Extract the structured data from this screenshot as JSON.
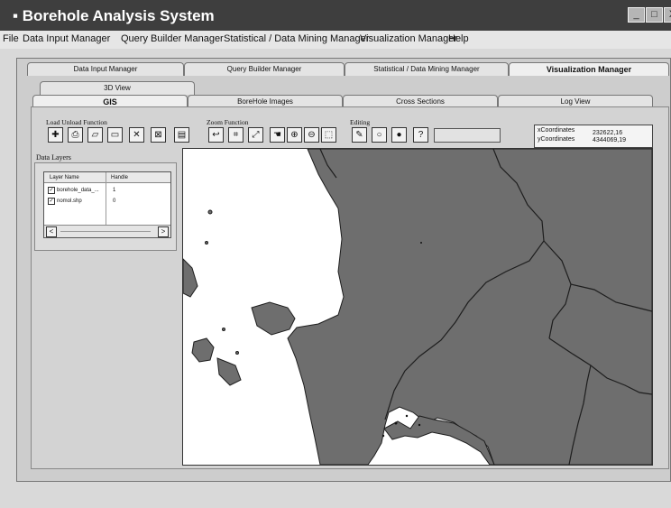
{
  "window": {
    "title": "Borehole Analysis System",
    "controls": {
      "minimize": "_",
      "maximize": "□",
      "close": "X"
    }
  },
  "menu": [
    "File",
    "Data Input Manager",
    "Query Builder Manager",
    "Statistical / Data Mining Manager",
    "Visualization Manager",
    "Help"
  ],
  "manager_tabs": [
    "Data Input Manager",
    "Query Builder Manager",
    "Statistical / Data Mining Manager",
    "Visualization Manager"
  ],
  "view_tabs": {
    "row1": [
      "3D View"
    ],
    "row2": [
      "GIS",
      "BoreHole Images",
      "Cross Sections",
      "Log View"
    ]
  },
  "toolbar": {
    "load_label": "Load Unload Function",
    "zoom_label": "Zoom Function",
    "editing_label": "Editing"
  },
  "coordinates": {
    "x_label": "xCoordinates",
    "x_value": "232622,16",
    "y_label": "yCoordinates",
    "y_value": "4344069,19"
  },
  "data_layers": {
    "title": "Data Layers",
    "columns": [
      "Layer Name",
      "Handle"
    ],
    "rows": [
      {
        "name": "borehole_data_...",
        "handle": "1",
        "checked": true
      },
      {
        "name": "nomol.shp",
        "handle": "0",
        "checked": true
      }
    ],
    "scroll_left": "<",
    "scroll_right": ">"
  },
  "colors": {
    "land": "#6e6e6e",
    "sea": "#ffffff",
    "title_bar": "#3e3e3e"
  }
}
